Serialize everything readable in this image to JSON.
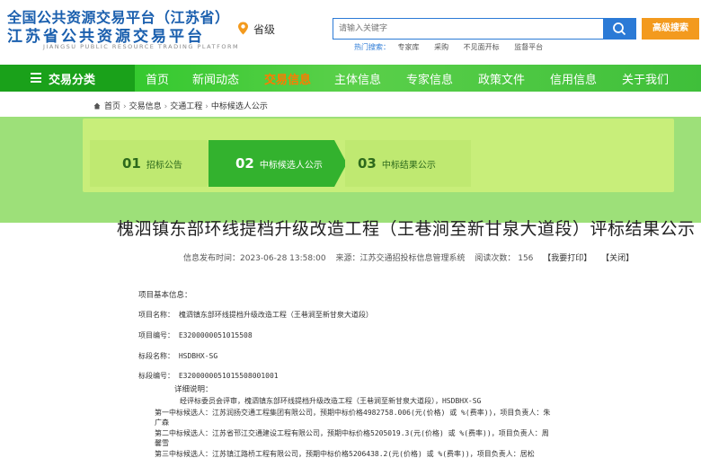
{
  "header": {
    "logo_line1": "全国公共资源交易平台（江苏省）",
    "logo_line2": "江苏省公共资源交易平台",
    "logo_line3": "JIANGSU PUBLIC RESOURCE TRADING PLATFORM",
    "location": "省级",
    "search_placeholder": "请输入关键字",
    "advanced_search": "高级搜索",
    "hot_label": "热门搜索：",
    "hot_items": [
      "专家库",
      "采购",
      "不见面开标",
      "监督平台"
    ]
  },
  "nav": {
    "category_label": "交易分类",
    "items": [
      "首页",
      "新闻动态",
      "交易信息",
      "主体信息",
      "专家信息",
      "政策文件",
      "信用信息",
      "关于我们"
    ],
    "active": "交易信息"
  },
  "breadcrumb": [
    "首页",
    "交易信息",
    "交通工程",
    "中标候选人公示"
  ],
  "steps": [
    {
      "num": "01",
      "label": "招标公告"
    },
    {
      "num": "02",
      "label": "中标候选人公示"
    },
    {
      "num": "03",
      "label": "中标结果公示"
    }
  ],
  "title": "槐泗镇东部环线提档升级改造工程（王巷涧至新甘泉大道段）评标结果公示",
  "meta": {
    "time": "信息发布时间：2023-06-28 13:58:00",
    "source": "来源：江苏交通招投标信息管理系统",
    "views": "阅读次数：  156",
    "print": "【我要打印】",
    "close": "【关闭】"
  },
  "details": {
    "basic_info": "项目基本信息：",
    "project_name": "项目名称：  槐泗镇东部环线提档升级改造工程（王巷涧至新甘泉大道段）",
    "project_no": "项目编号：  E3200000051015508",
    "section_name": "标段名称：  HSDBHX-SG",
    "section_no": "标段编号：  E3200000051015508001001",
    "desc_label": "详细说明：",
    "desc_line1": "经评标委员会评审，槐泗镇东部环线提档升级改造工程（王巷涧至新甘泉大道段），HSDBHX-SG",
    "cand1_a": "第一中标候选人：江苏润扬交通工程集团有限公司，预期中标价格4982758.006(元(价格) 或 %(费率))，项目负责人：朱",
    "cand1_b": "广森",
    "cand2_a": "第二中标候选人：江苏省邗江交通建设工程有限公司，预期中标价格5205019.3(元(价格) 或 %(费率))，项目负责人：周",
    "cand2_b": "馨雪",
    "cand3_a": "第三中标候选人：江苏镇江路桥工程有限公司，预期中标价格5206438.2(元(价格) 或 %(费率))，项目负责人：居松"
  }
}
